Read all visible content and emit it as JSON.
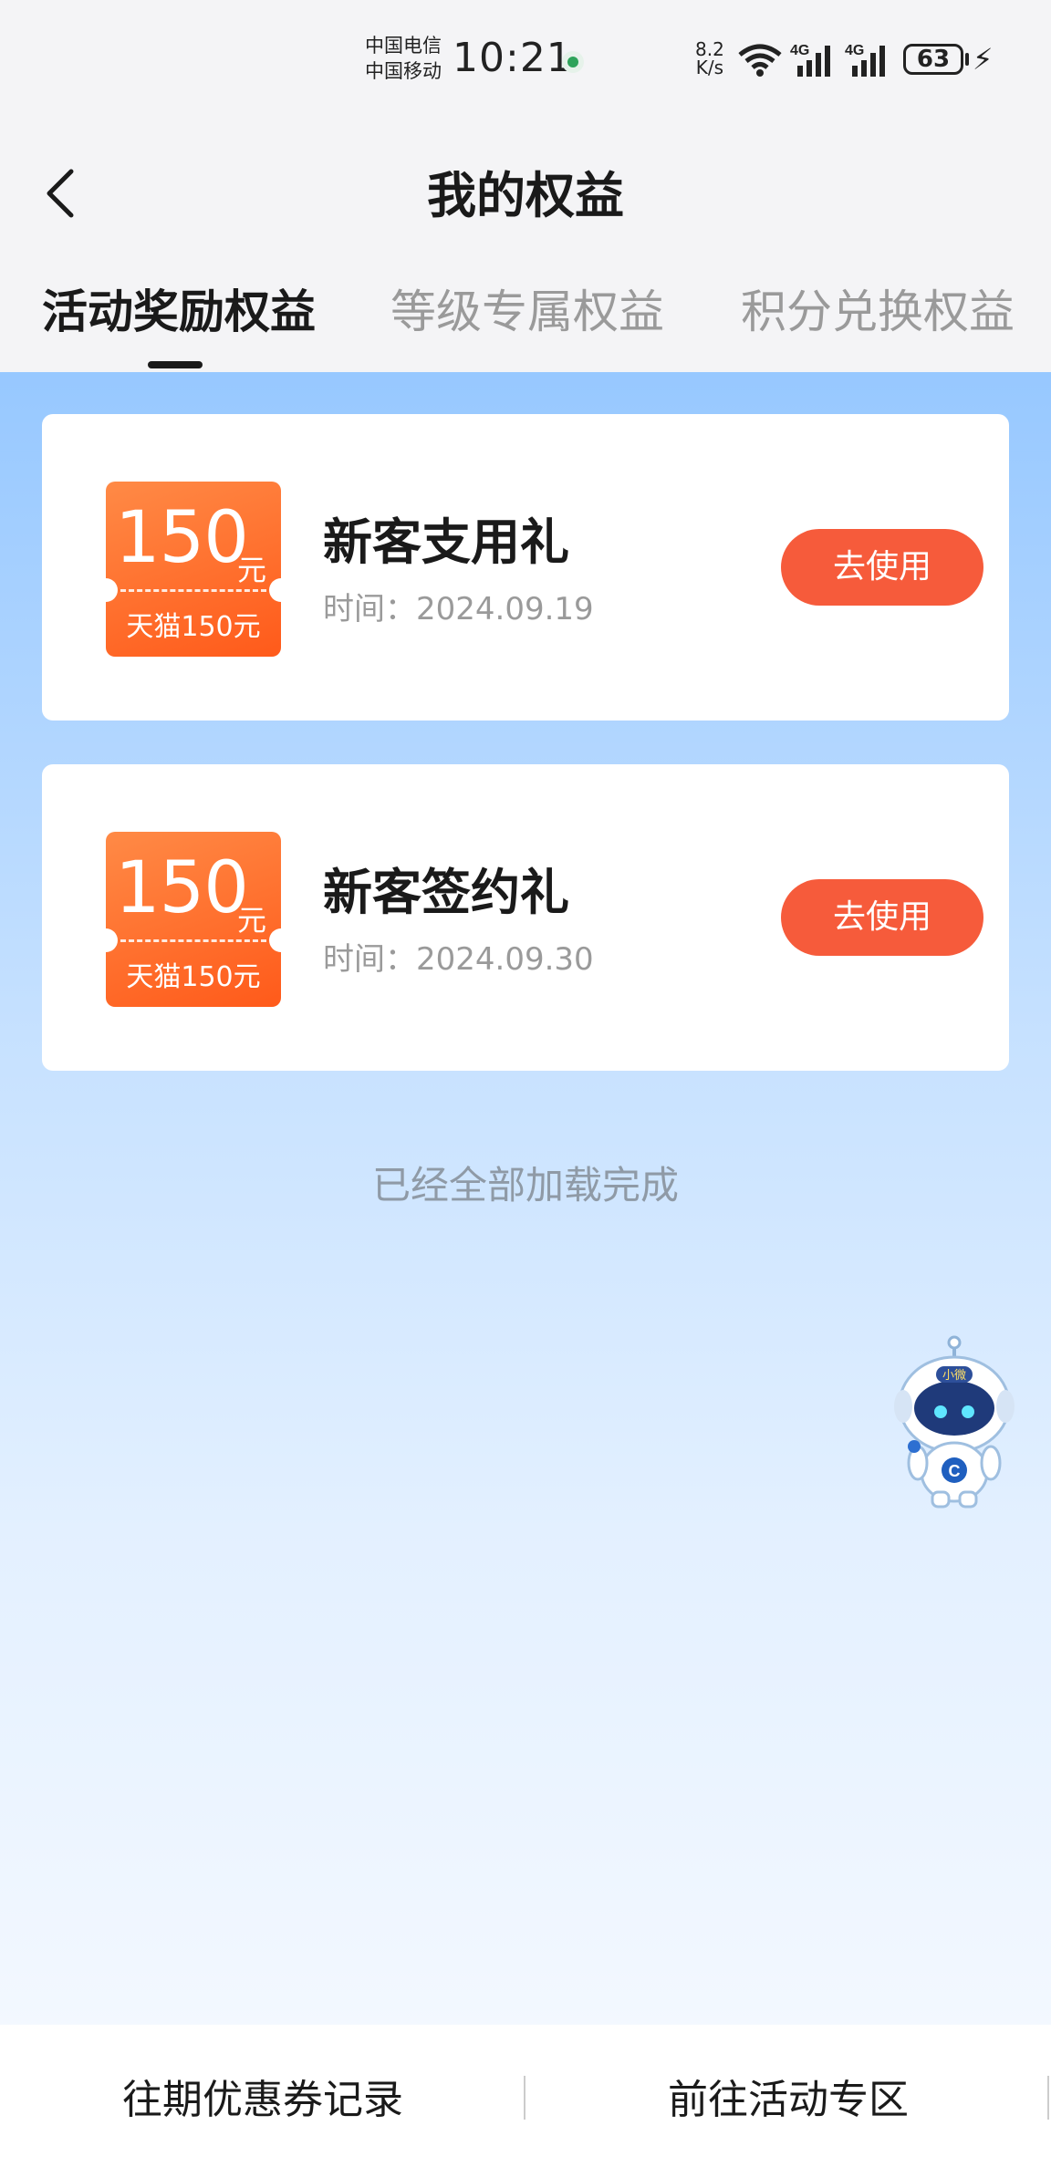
{
  "status_bar": {
    "carrier1": "中国电信",
    "carrier2": "中国移动",
    "time": "10:21",
    "speed_value": "8.2",
    "speed_unit": "K/s",
    "network1": "4G",
    "network2": "4G",
    "battery": "63"
  },
  "header": {
    "title": "我的权益"
  },
  "tabs": [
    {
      "label": "活动奖励权益",
      "active": true
    },
    {
      "label": "等级专属权益",
      "active": false
    },
    {
      "label": "积分兑换权益",
      "active": false
    }
  ],
  "cards": [
    {
      "coupon_amount": "150",
      "coupon_unit": "元",
      "coupon_desc": "天猫150元",
      "title": "新客支用礼",
      "time": "时间：2024.09.19",
      "button": "去使用"
    },
    {
      "coupon_amount": "150",
      "coupon_unit": "元",
      "coupon_desc": "天猫150元",
      "title": "新客签约礼",
      "time": "时间：2024.09.30",
      "button": "去使用"
    }
  ],
  "loaded_text": "已经全部加载完成",
  "assistant": {
    "badge": "小微"
  },
  "bottom": {
    "history": "往期优惠券记录",
    "activity": "前往活动专区"
  },
  "colors": {
    "accent": "#f65b3b",
    "coupon": "#ff6a2a",
    "bg_top": "#97c8ff"
  }
}
